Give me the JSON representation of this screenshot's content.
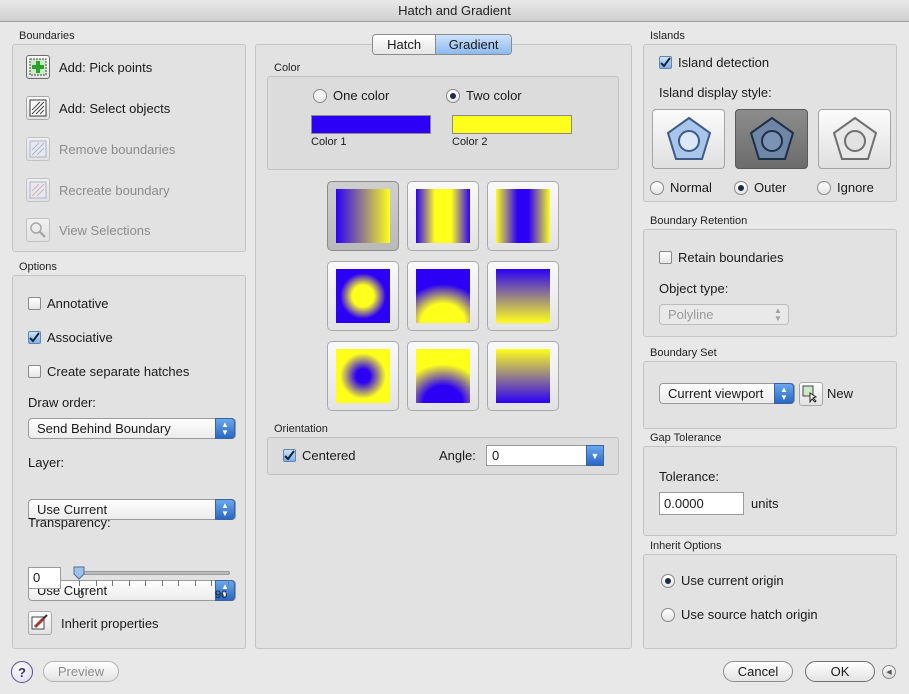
{
  "window": {
    "title": "Hatch and Gradient"
  },
  "tabs": {
    "hatch": "Hatch",
    "gradient": "Gradient",
    "selected": "Gradient"
  },
  "boundaries": {
    "label": "Boundaries",
    "pick_points": "Add: Pick points",
    "select_objects": "Add: Select objects",
    "remove": "Remove boundaries",
    "recreate": "Recreate boundary",
    "view_selections": "View Selections"
  },
  "options": {
    "label": "Options",
    "annotative": "Annotative",
    "associative": "Associative",
    "separate": "Create separate hatches",
    "draw_order_label": "Draw order:",
    "draw_order_value": "Send Behind Boundary",
    "layer_label": "Layer:",
    "layer_value": "Use Current",
    "transparency_label": "Transparency:",
    "transparency_value": "Use Current",
    "transparency_number": "0",
    "slider_min": "0",
    "slider_max": "90",
    "inherit": "Inherit properties",
    "checks": {
      "annotative": false,
      "associative": true,
      "separate": false
    }
  },
  "color": {
    "label": "Color",
    "one_color": "One color",
    "two_color": "Two color",
    "selected": "Two color",
    "color1_label": "Color 1",
    "color2_label": "Color 2",
    "color1": "#2b00f5",
    "color2": "#ffff1c"
  },
  "orientation": {
    "label": "Orientation",
    "centered": "Centered",
    "centered_checked": true,
    "angle_label": "Angle:",
    "angle_value": "0"
  },
  "islands": {
    "label": "Islands",
    "detection": "Island detection",
    "detection_checked": true,
    "display_style_label": "Island display style:",
    "normal": "Normal",
    "outer": "Outer",
    "ignore": "Ignore",
    "selected": "Outer"
  },
  "retention": {
    "label": "Boundary Retention",
    "retain": "Retain boundaries",
    "retain_checked": false,
    "object_type_label": "Object type:",
    "object_type_value": "Polyline"
  },
  "boundary_set": {
    "label": "Boundary Set",
    "value": "Current viewport",
    "new_label": "New"
  },
  "gap": {
    "label": "Gap Tolerance",
    "tolerance_label": "Tolerance:",
    "value": "0.0000",
    "units": "units"
  },
  "inherit_options": {
    "label": "Inherit Options",
    "current": "Use current origin",
    "source": "Use source hatch origin",
    "selected": "Use current origin"
  },
  "footer": {
    "help": "?",
    "preview": "Preview",
    "cancel": "Cancel",
    "ok": "OK"
  }
}
